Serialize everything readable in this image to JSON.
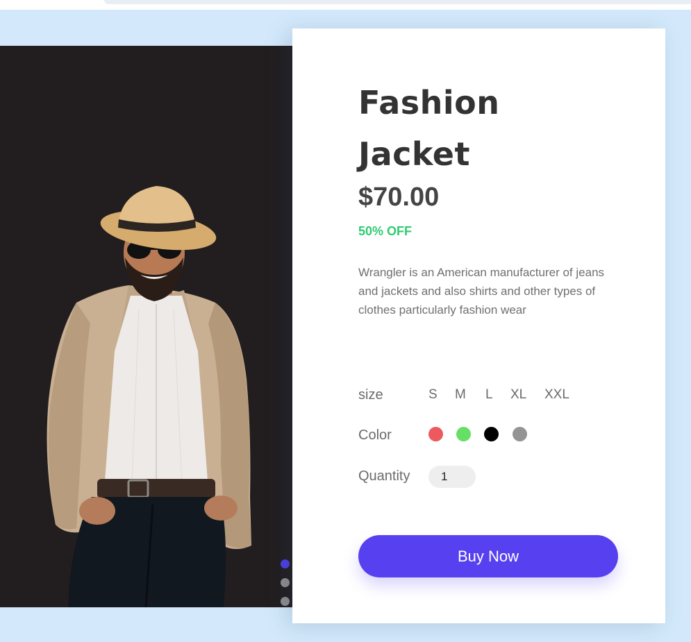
{
  "product": {
    "title": "Fashion Jacket",
    "price": "$70.00",
    "discount": "50% OFF",
    "description": "Wrangler is an American manufacturer of jeans and jackets and also shirts and other types of clothes particularly fashion wear",
    "image_alt": "man in hat, sunglasses and beige jacket"
  },
  "options": {
    "size_label": "size",
    "sizes": [
      "S",
      "M",
      "L",
      "XL",
      "XXL"
    ],
    "color_label": "Color",
    "colors": [
      "#ec5a5f",
      "#66df66",
      "#000000",
      "#949494"
    ],
    "quantity_label": "Quantity",
    "quantity_value": "1"
  },
  "actions": {
    "buy_label": "Buy Now"
  },
  "slider": {
    "count": 3,
    "active_index": 0
  },
  "theme": {
    "accent": "#5640f0",
    "discount": "#2ecc71",
    "background": "#d3e9fb"
  }
}
